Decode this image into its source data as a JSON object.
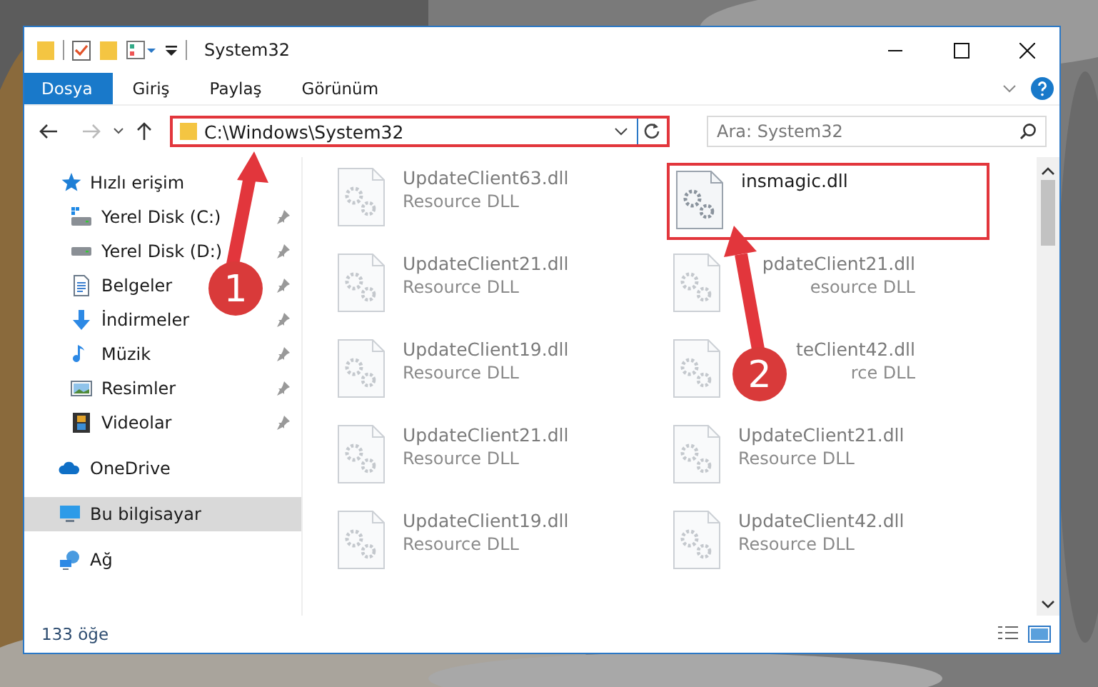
{
  "window": {
    "title": "System32"
  },
  "ribbon": {
    "tabs": [
      {
        "label": "Dosya",
        "selected": true
      },
      {
        "label": "Giriş",
        "selected": false
      },
      {
        "label": "Paylaş",
        "selected": false
      },
      {
        "label": "Görünüm",
        "selected": false
      }
    ]
  },
  "address": {
    "path": "C:\\Windows\\System32",
    "highlighted": true
  },
  "search": {
    "placeholder": "Ara: System32"
  },
  "sidebar": {
    "items": [
      {
        "label": "Hızlı erişim",
        "kind": "star",
        "selected": false,
        "children": [
          {
            "label": "Yerel Disk (C:)",
            "kind": "drive-windows",
            "pinned": true
          },
          {
            "label": "Yerel Disk (D:)",
            "kind": "drive",
            "pinned": true
          },
          {
            "label": "Belgeler",
            "kind": "document",
            "pinned": true
          },
          {
            "label": "İndirmeler",
            "kind": "download",
            "pinned": true
          },
          {
            "label": "Müzik",
            "kind": "music",
            "pinned": true
          },
          {
            "label": "Resimler",
            "kind": "pictures",
            "pinned": true
          },
          {
            "label": "Videolar",
            "kind": "video",
            "pinned": true
          }
        ]
      },
      {
        "label": "OneDrive",
        "kind": "cloud",
        "selected": false
      },
      {
        "label": "Bu bilgisayar",
        "kind": "computer",
        "selected": true
      },
      {
        "label": "Ağ",
        "kind": "network",
        "selected": false
      }
    ]
  },
  "files": [
    {
      "name": "UpdateClient63.dll",
      "type": "Resource DLL",
      "blurred": true,
      "highlighted": false,
      "covered": false
    },
    {
      "name": "insmagic.dll",
      "blurred": false,
      "highlighted": true,
      "covered": false
    },
    {
      "name": "UpdateClient21.dll",
      "type": "Resource DLL",
      "blurred": true,
      "highlighted": false,
      "covered": false
    },
    {
      "name": "pdateClient21.dll",
      "type": "esource DLL",
      "blurred": true,
      "highlighted": false,
      "covered": true
    },
    {
      "name": "UpdateClient19.dll",
      "type": "Resource DLL",
      "blurred": true,
      "highlighted": false,
      "covered": false
    },
    {
      "name": "teClient42.dll",
      "type": "rce DLL",
      "blurred": true,
      "highlighted": false,
      "covered": true
    },
    {
      "name": "UpdateClient21.dll",
      "type": "Resource DLL",
      "blurred": true,
      "highlighted": false,
      "covered": false
    },
    {
      "name": "UpdateClient21.dll",
      "type": "Resource DLL",
      "blurred": true,
      "highlighted": false,
      "covered": false
    },
    {
      "name": "UpdateClient19.dll",
      "type": "Resource DLL",
      "blurred": true,
      "highlighted": false,
      "covered": false
    },
    {
      "name": "UpdateClient42.dll",
      "type": "Resource DLL",
      "blurred": true,
      "highlighted": false,
      "covered": false
    }
  ],
  "status_bar": {
    "count": "133 öğe"
  },
  "annotations": [
    {
      "label": "1"
    },
    {
      "label": "2"
    }
  ]
}
